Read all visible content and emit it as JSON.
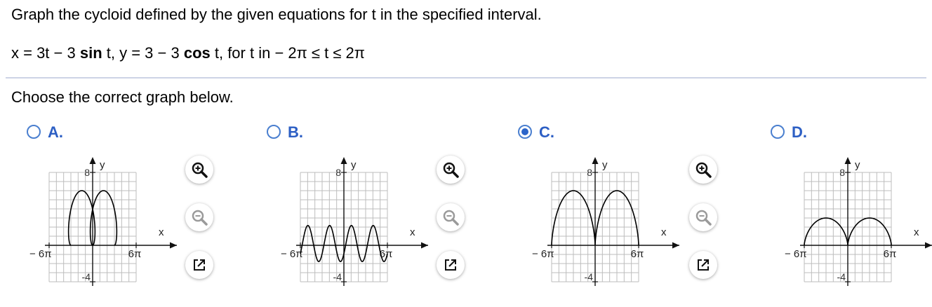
{
  "question": {
    "prompt": "Graph the cycloid defined by the given equations for t in the specified interval.",
    "eq_x_prefix": "x = 3t − 3 ",
    "eq_sin": "sin",
    "eq_mid": " t, y = 3 − 3 ",
    "eq_cos": "cos",
    "eq_suffix": " t, for t in  − 2π ≤ t ≤ 2π",
    "instruction": "Choose the correct graph below."
  },
  "colors": {
    "accent": "#2d5fc4",
    "radio_border": "#4a7fcf",
    "grid": "#b9b9b9",
    "divider": "#cdd3e6"
  },
  "icons": {
    "zoom_in": "zoom-in-icon",
    "zoom_out": "zoom-out-icon",
    "popout": "popout-icon"
  },
  "options": [
    {
      "letter": "A.",
      "selected": false
    },
    {
      "letter": "B.",
      "selected": false
    },
    {
      "letter": "C.",
      "selected": true
    },
    {
      "letter": "D.",
      "selected": false
    }
  ],
  "chart_data": [
    {
      "type": "line",
      "option": "A",
      "xlabel": "x",
      "ylabel": "y",
      "x_ticks": [
        "− 6π",
        "6π"
      ],
      "y_ticks": [
        "8",
        "-4"
      ],
      "series": [
        {
          "values": "tall narrow arches, peak ≈ 6, two arches between −6π and 6π"
        }
      ]
    },
    {
      "type": "line",
      "option": "B",
      "xlabel": "x",
      "ylabel": "y",
      "x_ticks": [
        "− 6π",
        "6π"
      ],
      "y_ticks": [
        "8",
        "-4"
      ],
      "series": [
        {
          "values": "wavy curve x = 3t − 3sin t, y = 3 − 3cos t swapped, oscillating around y ≈ 0"
        }
      ]
    },
    {
      "type": "line",
      "option": "C",
      "xlabel": "x",
      "ylabel": "y",
      "x_ticks": [
        "− 6π",
        "6π"
      ],
      "y_ticks": [
        "8",
        "-4"
      ],
      "series": [
        {
          "values": "cycloid arches, max y = 6 at x = ±3π, y = 0 at x = −6π, 0, 6π"
        }
      ]
    },
    {
      "type": "line",
      "option": "D",
      "xlabel": "x",
      "ylabel": "y",
      "x_ticks": [
        "− 6π",
        "6π"
      ],
      "y_ticks": [
        "8",
        "-4"
      ],
      "series": [
        {
          "values": "low arches, max y = 3 at x = ±3π"
        }
      ]
    }
  ]
}
